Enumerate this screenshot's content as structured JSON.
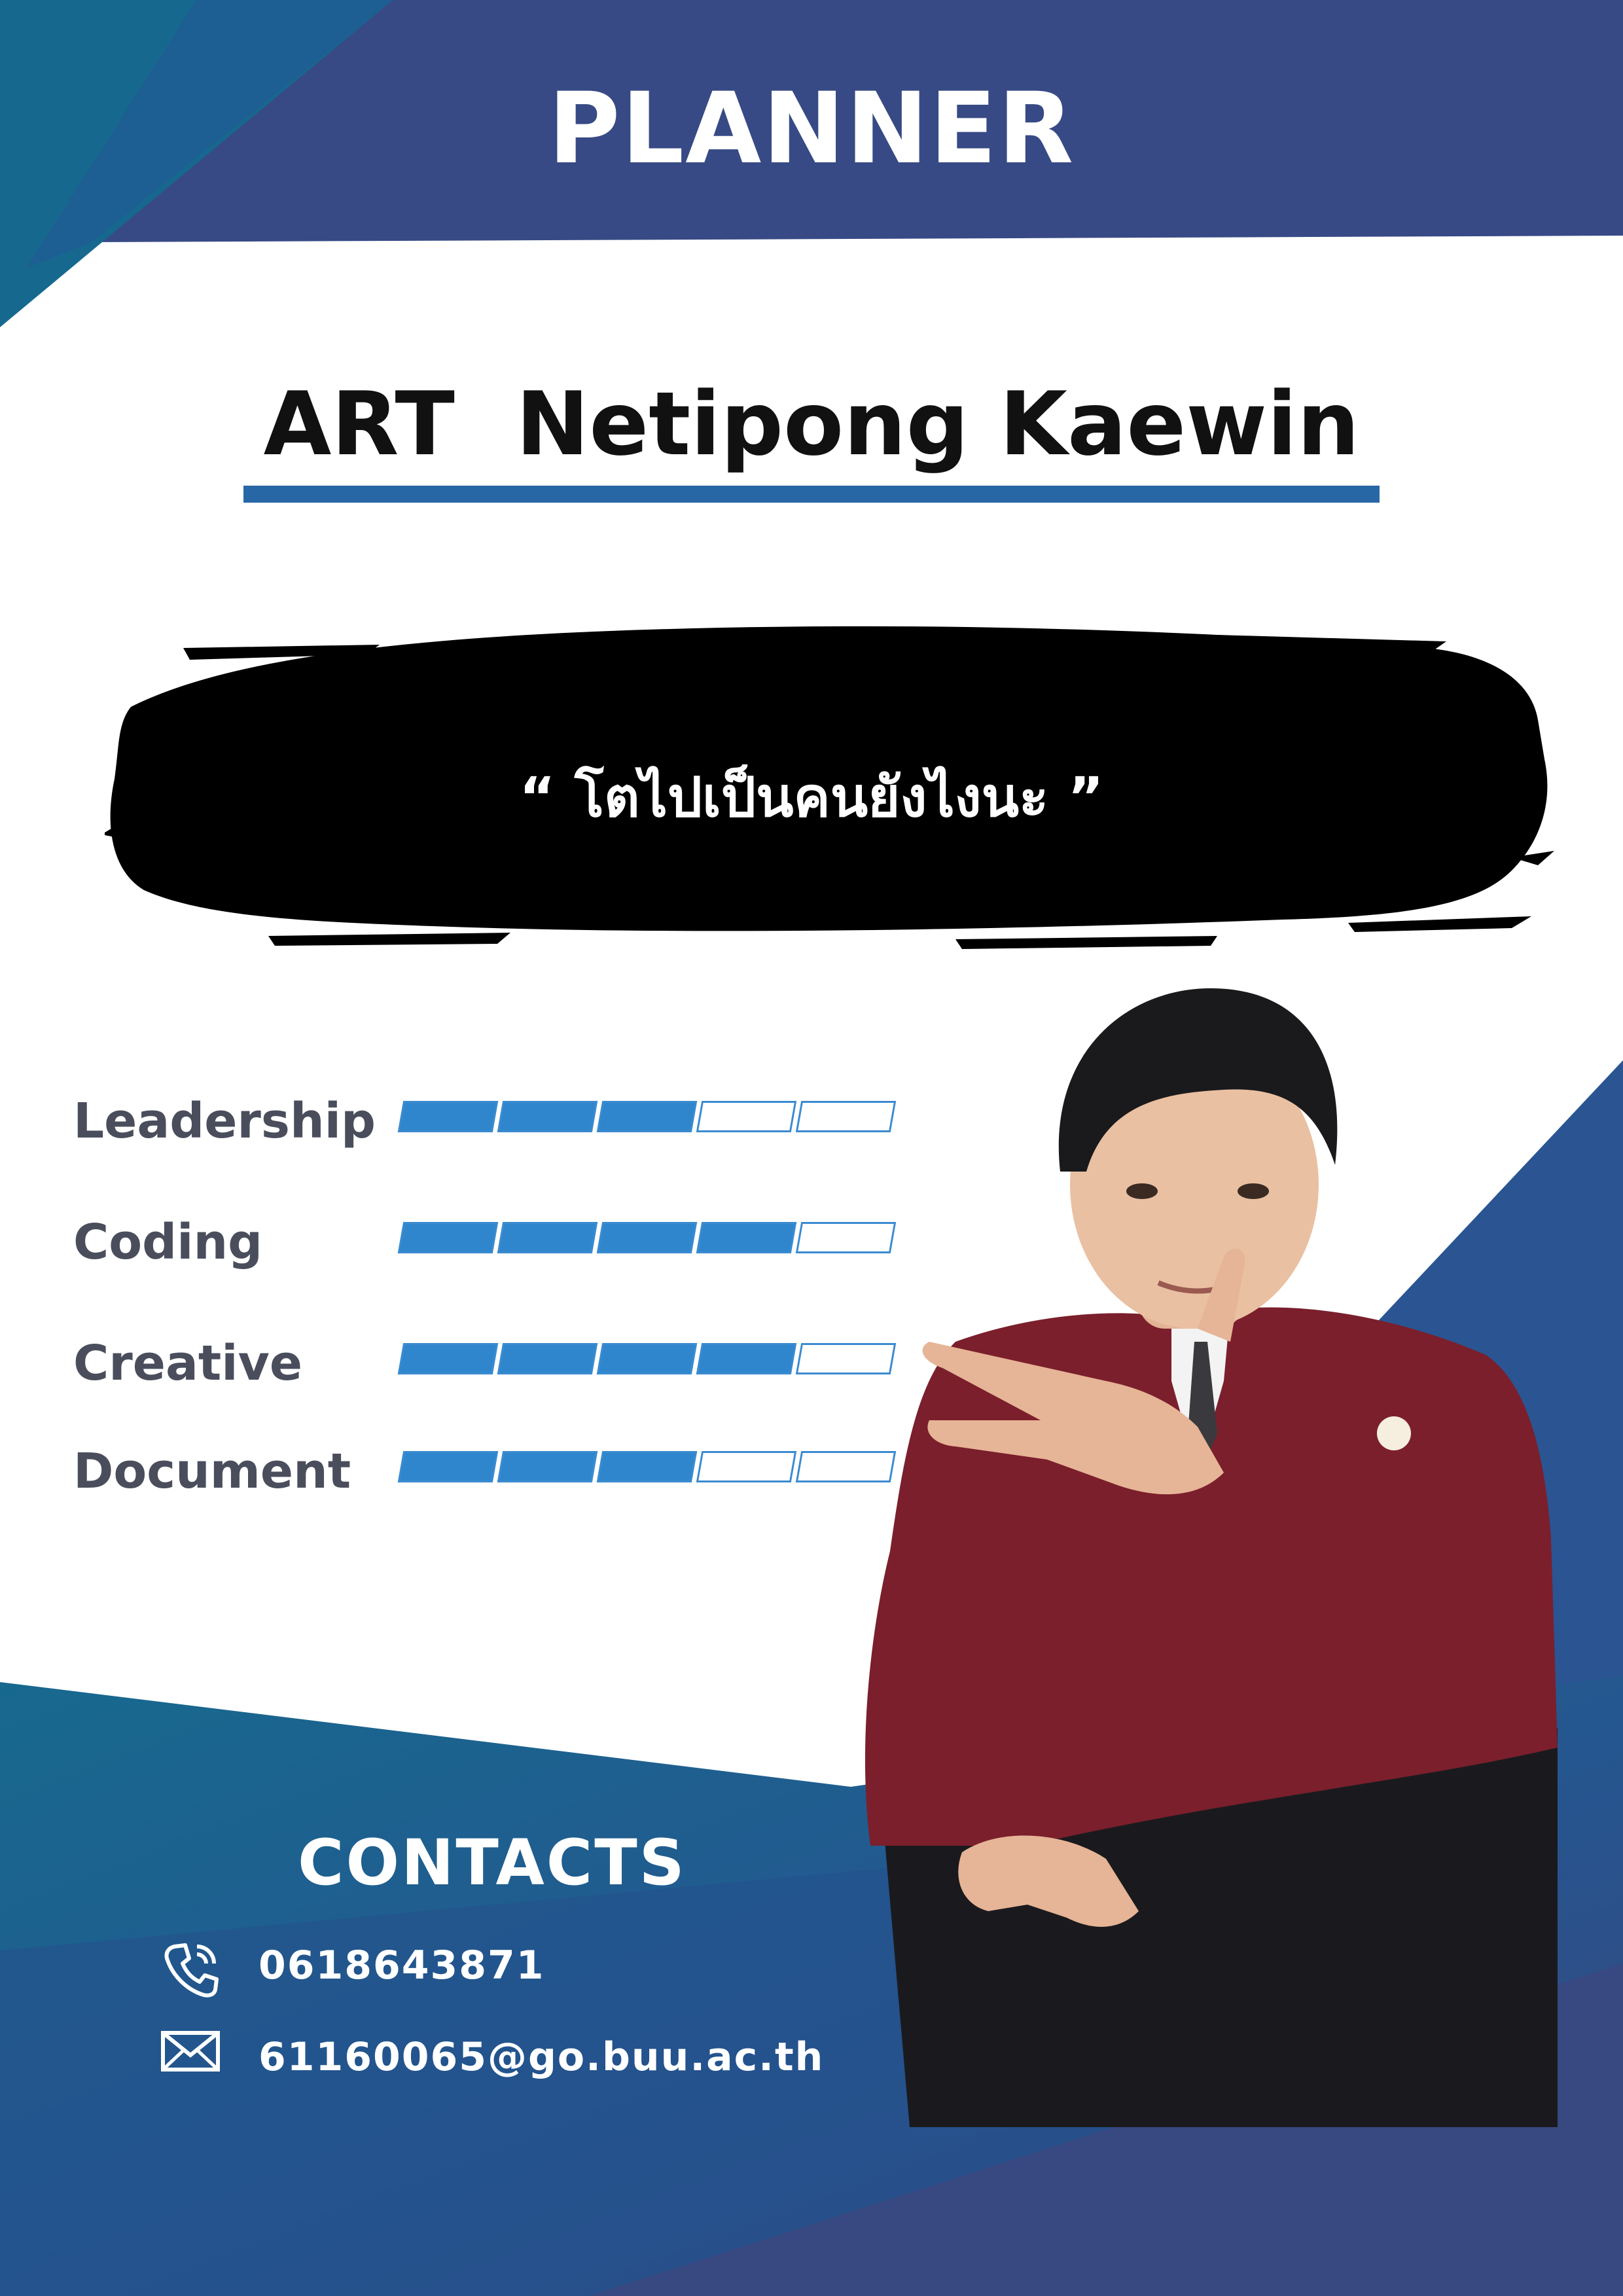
{
  "header": {
    "title": "PLANNER"
  },
  "profile": {
    "name": "ART  Netipong Kaewin",
    "quote": "“ โตไปเป็นคนยังไงนะ ”"
  },
  "skills": [
    {
      "label": "Leadership",
      "level": 3,
      "max": 5
    },
    {
      "label": "Coding",
      "level": 4,
      "max": 5
    },
    {
      "label": "Creative",
      "level": 4,
      "max": 5
    },
    {
      "label": "Document",
      "level": 3,
      "max": 5
    }
  ],
  "contacts": {
    "title": "CONTACTS",
    "phone": {
      "icon": "phone-icon",
      "value": "0618643871"
    },
    "email": {
      "icon": "mail-icon",
      "value": "61160065@go.buu.ac.th"
    }
  },
  "colors": {
    "navy": "#3a4c86",
    "teal": "#17698f",
    "bar_fill": "#2f86cc",
    "underline": "#2867a6"
  }
}
